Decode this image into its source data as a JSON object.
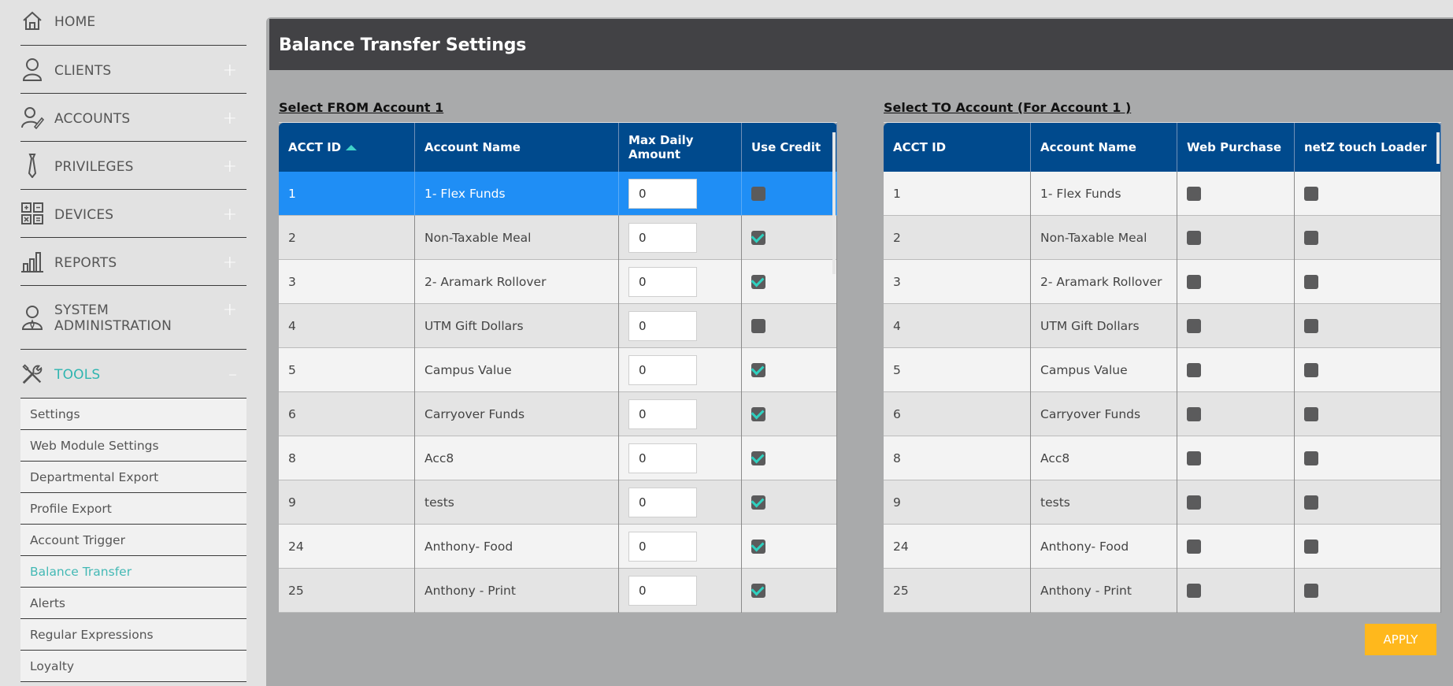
{
  "sidebar": {
    "items": [
      {
        "label": "HOME",
        "icon": "home-icon",
        "expand": ""
      },
      {
        "label": "CLIENTS",
        "icon": "user-icon",
        "expand": "+"
      },
      {
        "label": "ACCOUNTS",
        "icon": "user-edit-icon",
        "expand": "+"
      },
      {
        "label": "PRIVILEGES",
        "icon": "tie-icon",
        "expand": "+"
      },
      {
        "label": "DEVICES",
        "icon": "calculator-icon",
        "expand": "+"
      },
      {
        "label": "REPORTS",
        "icon": "bar-chart-icon",
        "expand": "+"
      },
      {
        "label": "SYSTEM\nADMINISTRATION",
        "icon": "admin-user-icon",
        "expand": "+"
      },
      {
        "label": "TOOLS",
        "icon": "tools-icon",
        "expand": "–"
      }
    ],
    "tools_sub": [
      "Settings",
      "Web Module Settings",
      "Departmental Export",
      "Profile Export",
      "Account Trigger",
      "Balance Transfer",
      "Alerts",
      "Regular Expressions",
      "Loyalty"
    ],
    "active_sub": "Balance Transfer",
    "accent_color": "#2fb5b0"
  },
  "page": {
    "title": "Balance Transfer Settings",
    "from_title": "Select FROM Account 1",
    "to_title": "Select TO Account (For Account 1 )",
    "apply_label": "APPLY"
  },
  "from_table": {
    "headers": [
      "ACCT ID",
      "Account Name",
      "Max Daily\nAmount",
      "Use Credit"
    ],
    "sorted_column": "ACCT ID",
    "rows": [
      {
        "id": "1",
        "name": "1- Flex Funds",
        "max": "0",
        "use_credit": false,
        "selected": true
      },
      {
        "id": "2",
        "name": "Non-Taxable Meal",
        "max": "0",
        "use_credit": true
      },
      {
        "id": "3",
        "name": "2- Aramark Rollover",
        "max": "0",
        "use_credit": true
      },
      {
        "id": "4",
        "name": "UTM Gift Dollars",
        "max": "0",
        "use_credit": false
      },
      {
        "id": "5",
        "name": "Campus Value",
        "max": "0",
        "use_credit": true
      },
      {
        "id": "6",
        "name": "Carryover Funds",
        "max": "0",
        "use_credit": true
      },
      {
        "id": "8",
        "name": "Acc8",
        "max": "0",
        "use_credit": true
      },
      {
        "id": "9",
        "name": "tests",
        "max": "0",
        "use_credit": true
      },
      {
        "id": "24",
        "name": "Anthony- Food",
        "max": "0",
        "use_credit": true
      },
      {
        "id": "25",
        "name": "Anthony - Print",
        "max": "0",
        "use_credit": true
      }
    ]
  },
  "to_table": {
    "headers": [
      "ACCT ID",
      "Account Name",
      "Web Purchase",
      "netZ touch Loader"
    ],
    "rows": [
      {
        "id": "1",
        "name": "1- Flex Funds",
        "web": false,
        "netz": false
      },
      {
        "id": "2",
        "name": "Non-Taxable Meal",
        "web": false,
        "netz": false
      },
      {
        "id": "3",
        "name": "2- Aramark Rollover",
        "web": false,
        "netz": false
      },
      {
        "id": "4",
        "name": "UTM Gift Dollars",
        "web": false,
        "netz": false
      },
      {
        "id": "5",
        "name": "Campus Value",
        "web": false,
        "netz": false
      },
      {
        "id": "6",
        "name": "Carryover Funds",
        "web": false,
        "netz": false
      },
      {
        "id": "8",
        "name": "Acc8",
        "web": false,
        "netz": false
      },
      {
        "id": "9",
        "name": "tests",
        "web": false,
        "netz": false
      },
      {
        "id": "24",
        "name": "Anthony- Food",
        "web": false,
        "netz": false
      },
      {
        "id": "25",
        "name": "Anthony - Print",
        "web": false,
        "netz": false
      }
    ]
  },
  "colors": {
    "table_header": "#004a8d",
    "selected_row": "#1f8ef5",
    "check_mark": "#2fd1c0",
    "apply_button": "#ffb81c"
  }
}
